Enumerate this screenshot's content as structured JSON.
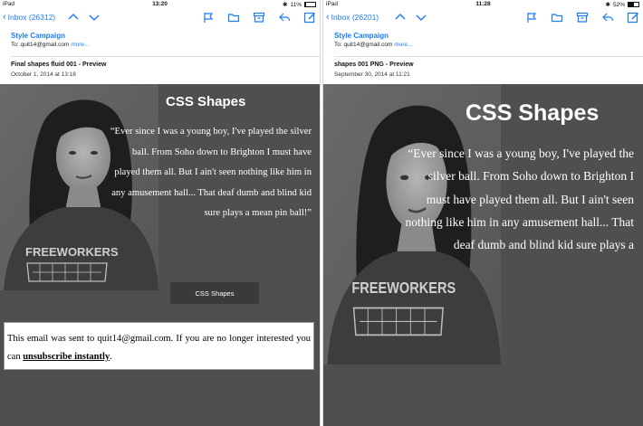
{
  "left": {
    "status": {
      "device": "iPad",
      "time": "13:20",
      "battery": "11%",
      "battery_fill": 0.11
    },
    "inbox_label": "Inbox (26312)",
    "sender": "Style Campaign",
    "to_prefix": "To:",
    "to_address": "quit14@gmail.com",
    "more": "more...",
    "subject": "Final shapes fluid 001 - Preview",
    "date": "October 1, 2014 at 13:18",
    "email": {
      "heading": "CSS Shapes",
      "quote": "“Ever since I was a young boy, I've played the silver ball. From Soho down to Brighton I must have played them all. But I ain't seen nothing like him in any amusement hall... That deaf dumb and blind kid sure plays a mean pin ball!”",
      "button_label": "CSS Shapes",
      "footer_text": "This email was sent to quit14@gmail.com. If you are no longer interested you can",
      "unsubscribe_label": "unsubscribe instantly",
      "footer_end": ".",
      "shirt_text": "FREEWORKERS"
    }
  },
  "right": {
    "status": {
      "device": "iPad",
      "time": "11:28",
      "battery": "52%",
      "battery_fill": 0.52
    },
    "inbox_label": "Inbox (26201)",
    "sender": "Style Campaign",
    "to_prefix": "To:",
    "to_address": "quit14@gmail.com",
    "more": "more...",
    "subject": "shapes 001 PNG - Preview",
    "date": "September 30, 2014 at 11:21",
    "email": {
      "heading": "CSS Shapes",
      "quote": "“Ever since I was a young boy, I've played the silver ball. From Soho down to Brighton I must have played them all. But I ain't seen nothing like him in any amusement hall... That deaf dumb and blind kid sure plays a",
      "shirt_text": "FREEWORKERS"
    }
  },
  "colors": {
    "accent": "#1a7cf5",
    "email_bg": "#4f4f4f"
  }
}
